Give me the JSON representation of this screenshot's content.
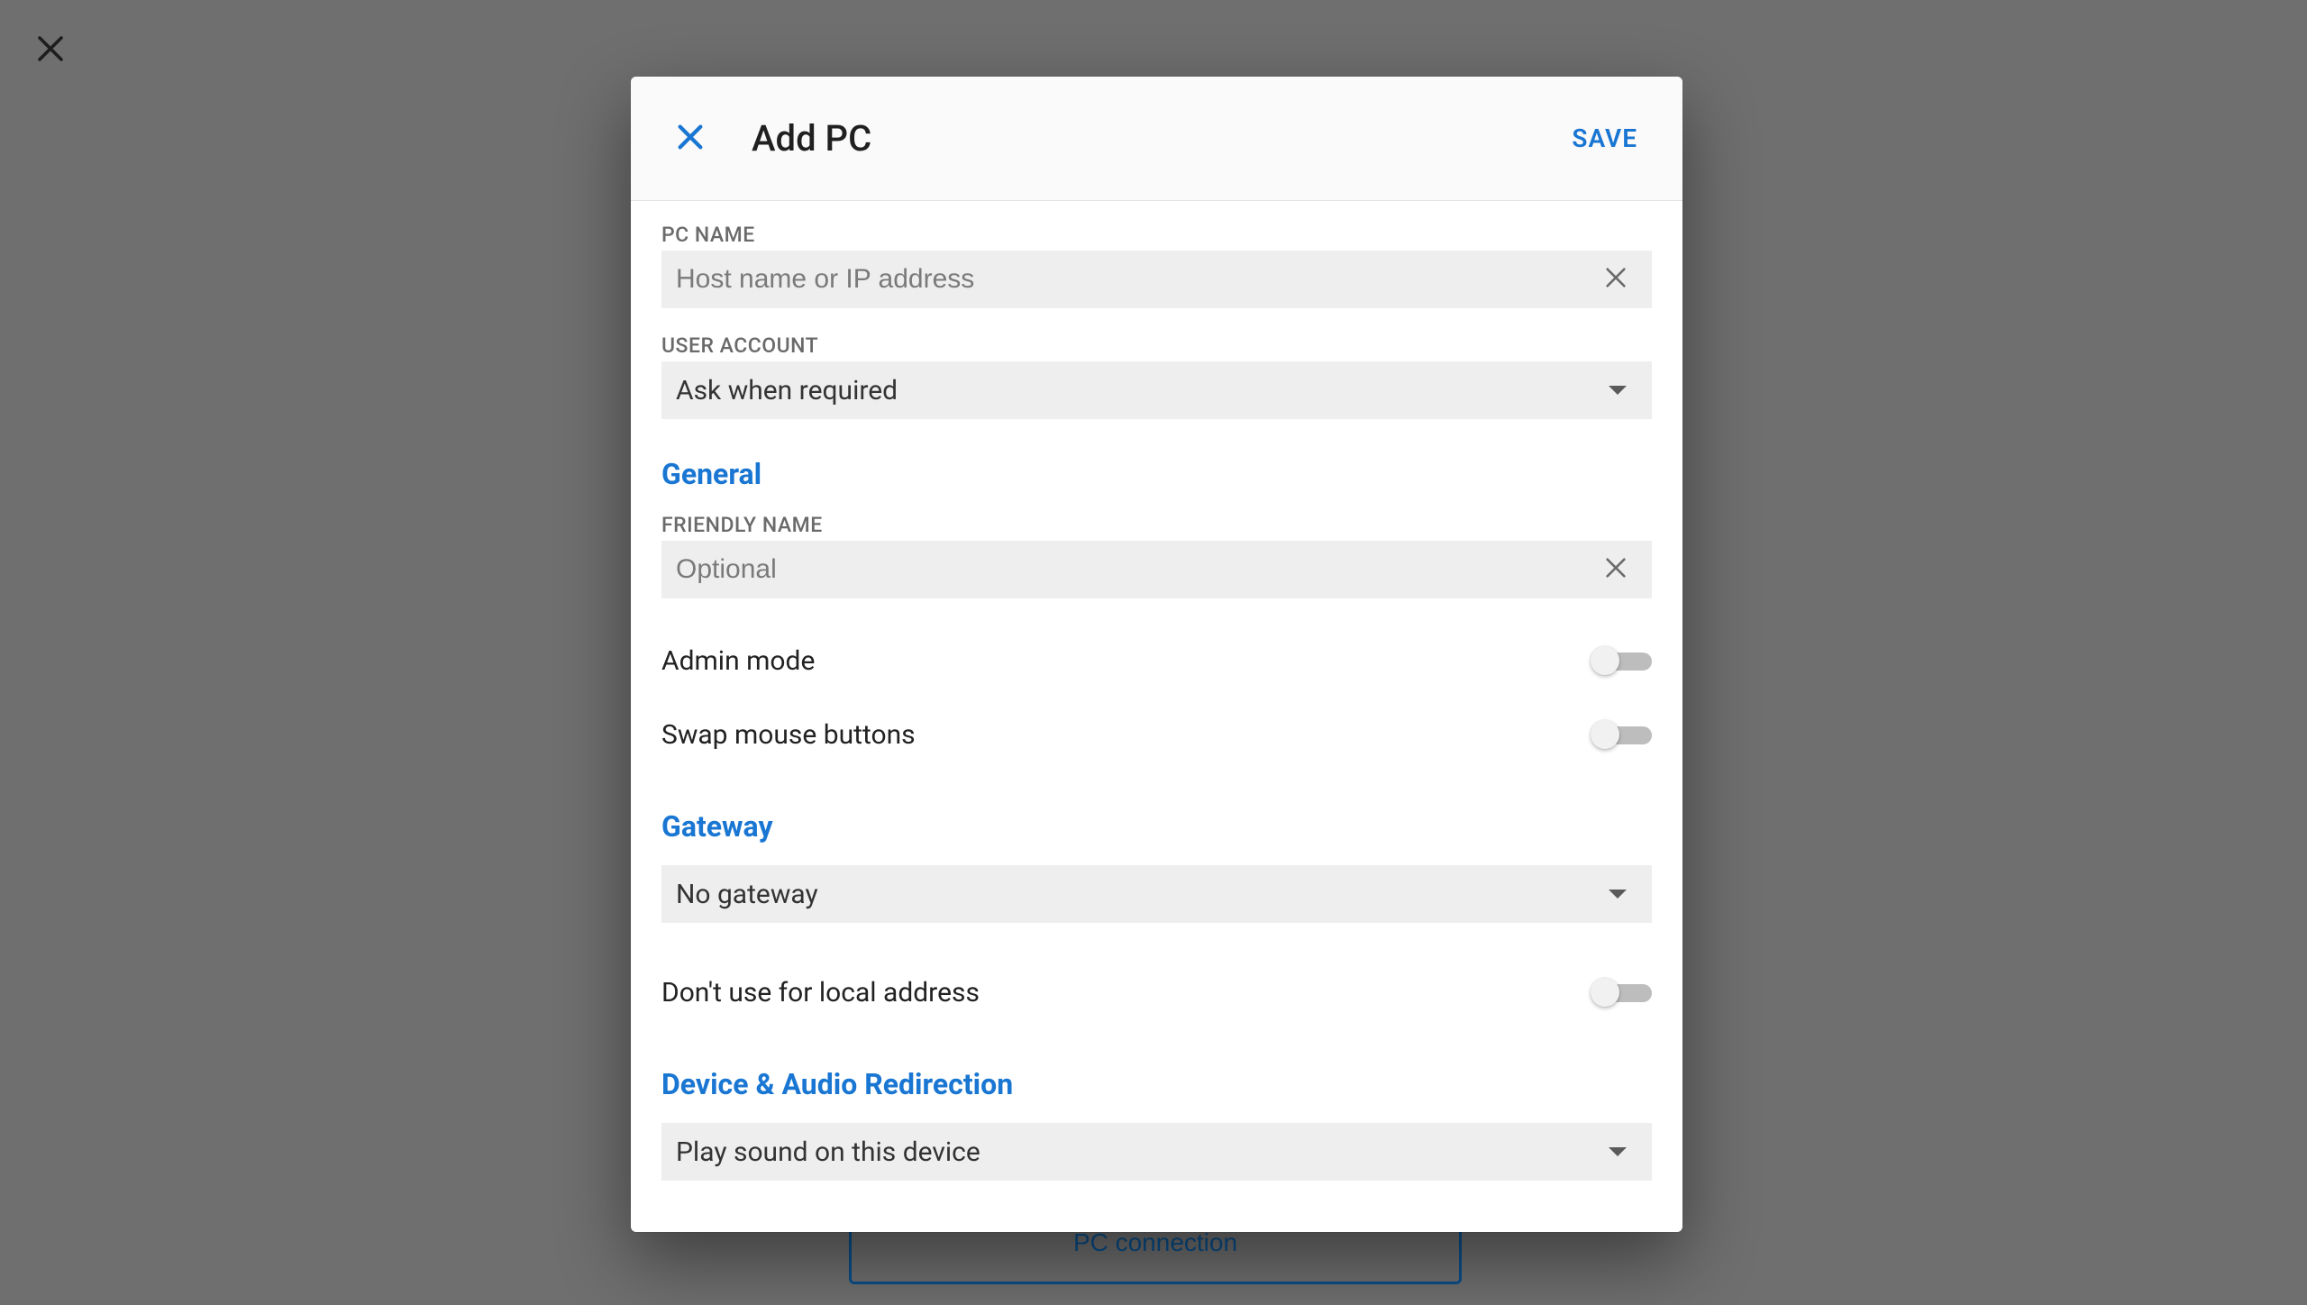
{
  "background": {
    "pc_connection_label": "PC connection"
  },
  "modal": {
    "title": "Add PC",
    "save_label": "SAVE",
    "pc_name": {
      "label": "PC NAME",
      "placeholder": "Host name or IP address",
      "value": ""
    },
    "user_account": {
      "label": "USER ACCOUNT",
      "selected": "Ask when required"
    },
    "sections": {
      "general": {
        "heading": "General",
        "friendly_name": {
          "label": "FRIENDLY NAME",
          "placeholder": "Optional",
          "value": ""
        },
        "admin_mode": {
          "label": "Admin mode",
          "on": false
        },
        "swap_mouse": {
          "label": "Swap mouse buttons",
          "on": false
        }
      },
      "gateway": {
        "heading": "Gateway",
        "selected": "No gateway",
        "no_local": {
          "label": "Don't use for local address",
          "on": false
        }
      },
      "audio": {
        "heading": "Device & Audio Redirection",
        "selected": "Play sound on this device"
      }
    }
  },
  "colors": {
    "accent": "#1976d2",
    "background_dim": "#6f6f6f"
  }
}
